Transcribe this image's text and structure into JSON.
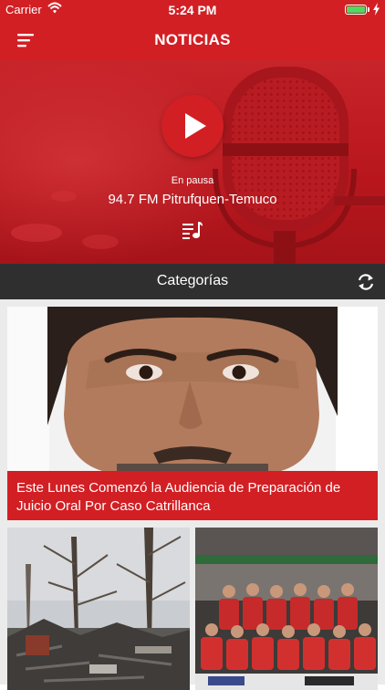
{
  "status_bar": {
    "carrier": "Carrier",
    "time": "5:24 PM",
    "icons": [
      "wifi-icon",
      "battery-icon",
      "charging-bolt-icon"
    ]
  },
  "nav": {
    "title": "NOTICIAS",
    "menu_icon": "menu-icon"
  },
  "player": {
    "state": "En pausa",
    "station": "94.7 FM Pitrufquen-Temuco",
    "play_icon": "play-icon",
    "playlist_icon": "playlist-icon"
  },
  "categories": {
    "label": "Categorías",
    "refresh_icon": "refresh-icon"
  },
  "featured": {
    "caption": "Este Lunes Comenzó la Audiencia de Preparación de Juicio Oral Por Caso Catrillanca"
  },
  "colors": {
    "brand_red": "#d21f24",
    "category_bar": "#2f2f2f",
    "feed_background": "#ebebeb"
  }
}
